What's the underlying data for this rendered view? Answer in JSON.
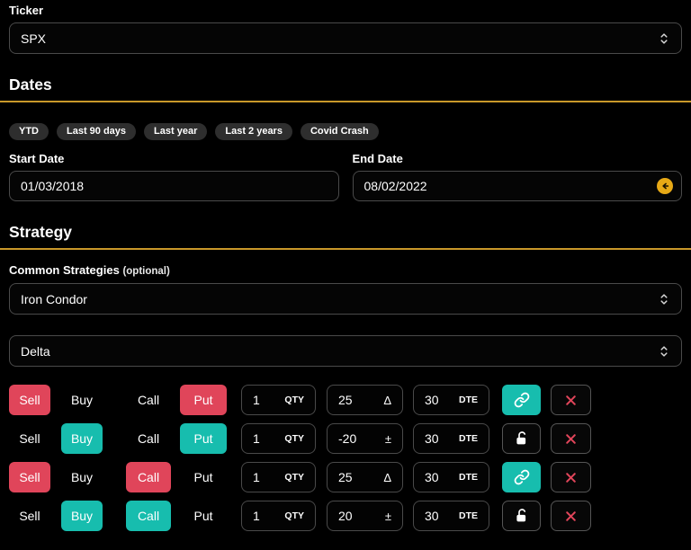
{
  "colors": {
    "accent_gold": "#c9982a",
    "red": "#e0455a",
    "teal": "#17bdae",
    "background": "#000000"
  },
  "ticker": {
    "label": "Ticker",
    "value": "SPX"
  },
  "dates": {
    "header": "Dates",
    "presets": [
      "YTD",
      "Last 90 days",
      "Last year",
      "Last 2 years",
      "Covid Crash"
    ],
    "start": {
      "label": "Start Date",
      "value": "01/03/2018"
    },
    "end": {
      "label": "End Date",
      "value": "08/02/2022"
    }
  },
  "strategy": {
    "header": "Strategy",
    "common_label": "Common Strategies",
    "common_optional": "(optional)",
    "common_value": "Iron Condor",
    "mode_value": "Delta",
    "toggle_labels": {
      "sell": "Sell",
      "buy": "Buy",
      "call": "Call",
      "put": "Put"
    },
    "legs": [
      {
        "side": "Sell",
        "option_type": "Put",
        "qty": "1",
        "qty_unit": "QTY",
        "value": "25",
        "value_unit": "Δ",
        "dte": "30",
        "dte_unit": "DTE",
        "linked": true
      },
      {
        "side": "Buy",
        "option_type": "Put",
        "qty": "1",
        "qty_unit": "QTY",
        "value": "-20",
        "value_unit": "±",
        "dte": "30",
        "dte_unit": "DTE",
        "linked": false
      },
      {
        "side": "Sell",
        "option_type": "Call",
        "qty": "1",
        "qty_unit": "QTY",
        "value": "25",
        "value_unit": "Δ",
        "dte": "30",
        "dte_unit": "DTE",
        "linked": true
      },
      {
        "side": "Buy",
        "option_type": "Call",
        "qty": "1",
        "qty_unit": "QTY",
        "value": "20",
        "value_unit": "±",
        "dte": "30",
        "dte_unit": "DTE",
        "linked": false
      }
    ]
  }
}
